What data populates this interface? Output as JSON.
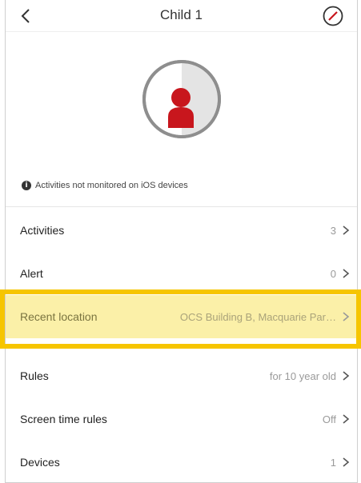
{
  "header": {
    "title": "Child 1",
    "back_icon": "chevron-left-icon",
    "compass_icon": "compass-icon"
  },
  "profile": {
    "avatar_icon": "child-avatar-icon",
    "avatar_color": "#c8161d"
  },
  "notice": {
    "icon": "info-icon",
    "text": "Activities not monitored on iOS devices"
  },
  "menu": {
    "items": [
      {
        "label": "Activities",
        "value": "3"
      },
      {
        "label": "Alert",
        "value": "0"
      },
      {
        "label": "Recent location",
        "value": "OCS Building B, Macquarie Par…"
      },
      {
        "label": "Rules",
        "value": "for 10 year old"
      },
      {
        "label": "Screen time rules",
        "value": "Off"
      },
      {
        "label": "Devices",
        "value": "1"
      }
    ]
  },
  "colors": {
    "highlight_fill": "#fbf0a8",
    "highlight_border": "#f6c500",
    "accent_red": "#c8161d"
  }
}
